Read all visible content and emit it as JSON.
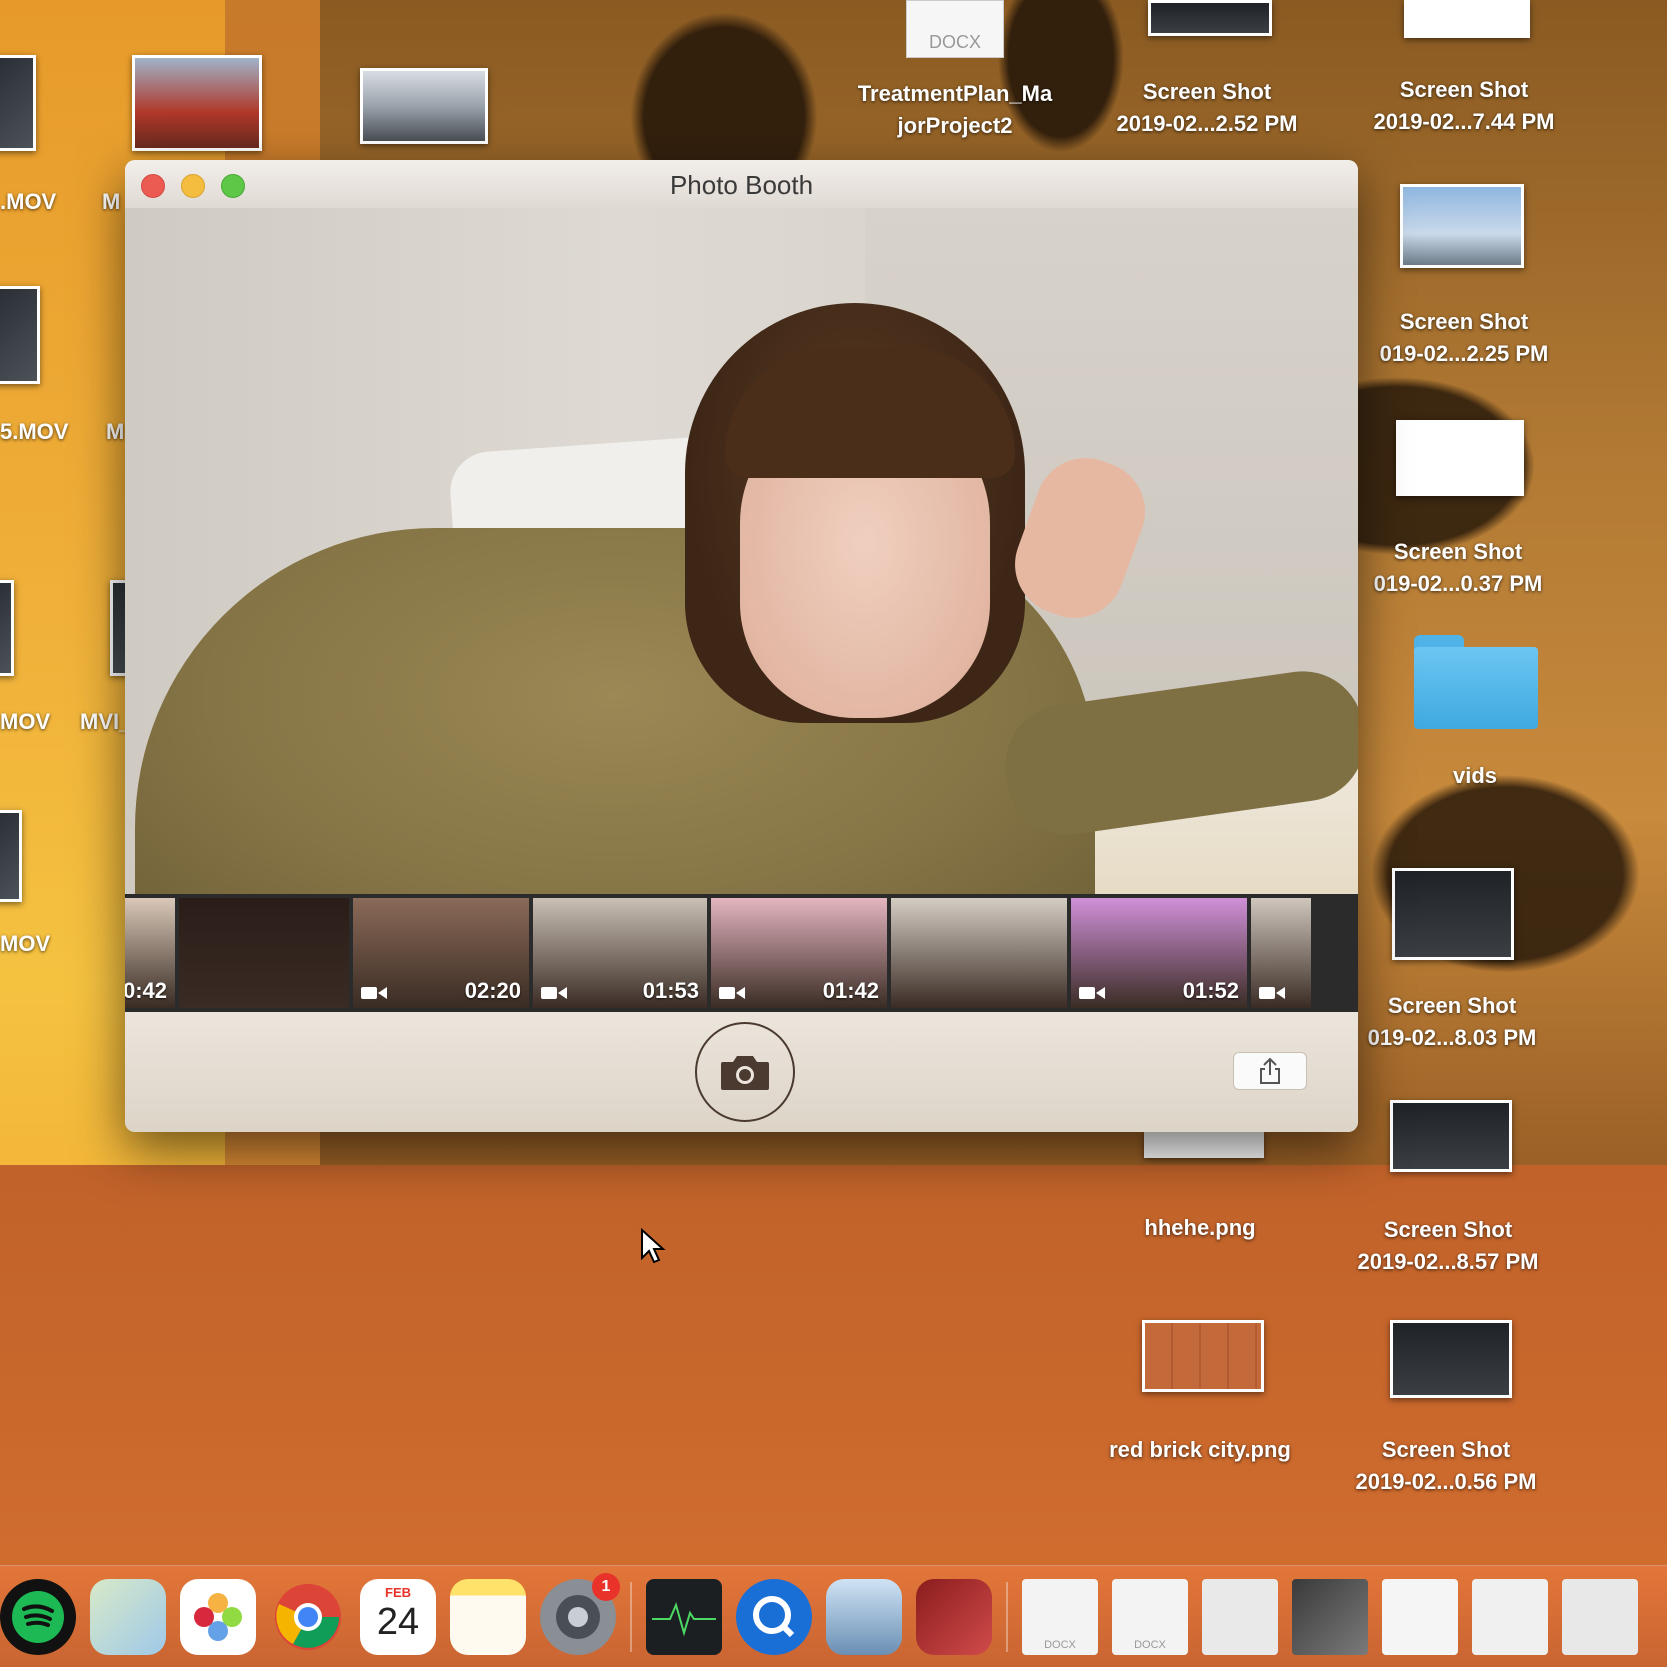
{
  "window": {
    "title": "Photo Booth"
  },
  "filmstrip": [
    {
      "duration": "0:42",
      "tone": "#d9c8b8"
    },
    {
      "duration": "",
      "tone": "#2a1d18"
    },
    {
      "duration": "02:20",
      "tone": "#8a6a58"
    },
    {
      "duration": "01:53",
      "tone": "#c9bfb5"
    },
    {
      "duration": "01:42",
      "tone": "#e5b5c0"
    },
    {
      "duration": "",
      "tone": "#d5cdc4"
    },
    {
      "duration": "01:52",
      "tone": "#d090d8"
    },
    {
      "duration": "",
      "tone": "#cfc6bd"
    }
  ],
  "desktop": {
    "left_labels": [
      ".MOV",
      "M",
      "5.MOV",
      "M",
      "MOV",
      "MVI_",
      "MOV"
    ],
    "icons": [
      {
        "label1": "TreatmentPlan_Ma",
        "label2": "jorProject2"
      },
      {
        "label1": "Screen Shot",
        "label2": "2019-02...2.52 PM"
      },
      {
        "label1": "Screen Shot",
        "label2": "2019-02...7.44 PM"
      },
      {
        "label1": "Screen Shot",
        "label2": "019-02...2.25 PM"
      },
      {
        "label1": "Screen Shot",
        "label2": "019-02...0.37 PM"
      },
      {
        "label1": "vids",
        "label2": ""
      },
      {
        "label1": "Screen Shot",
        "label2": "019-02...8.03 PM"
      },
      {
        "label1": "hhehe.png",
        "label2": ""
      },
      {
        "label1": "Screen Shot",
        "label2": "2019-02...8.57 PM"
      },
      {
        "label1": "red brick city.png",
        "label2": ""
      },
      {
        "label1": "Screen Shot",
        "label2": "2019-02...0.56 PM"
      }
    ],
    "doc_label": "DOCX"
  },
  "dock": {
    "calendar_month": "FEB",
    "calendar_day": "24",
    "system_prefs_badge": "1",
    "doc_labels": [
      "DOCX",
      "DOCX"
    ]
  }
}
